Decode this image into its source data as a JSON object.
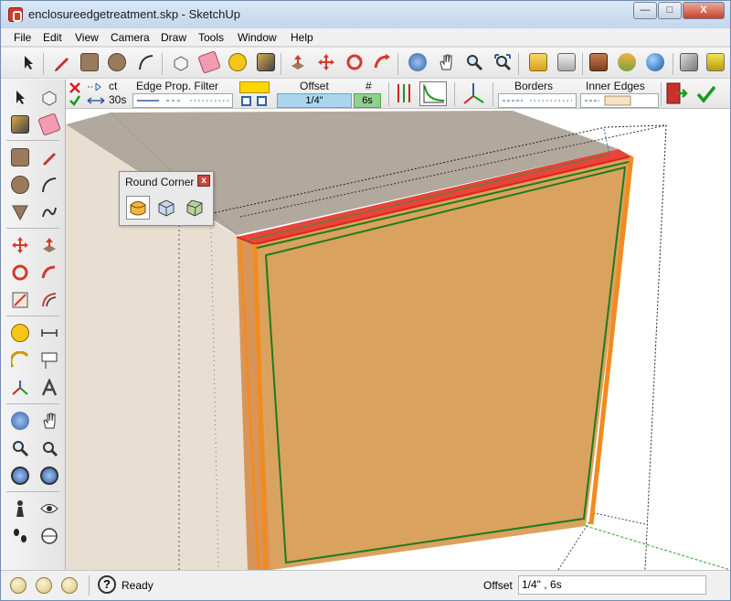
{
  "window": {
    "title": "enclosureedgetreatment.skp - SketchUp",
    "minimize": "—",
    "maximize": "□",
    "close": "X"
  },
  "menu": [
    "File",
    "Edit",
    "View",
    "Camera",
    "Draw",
    "Tools",
    "Window",
    "Help"
  ],
  "edge_treatment_toolbar": {
    "angle_label": "ct",
    "angle_value": "30s",
    "edge_filter_label": "Edge Prop. Filter",
    "offset_label": "Offset",
    "offset_value": "1/4\"",
    "segments_label": "#",
    "segments_value": "6s",
    "borders_label": "Borders",
    "inner_edges_label": "Inner Edges"
  },
  "round_corner_panel": {
    "title": "Round Corner",
    "close": "x",
    "tools": [
      "round-corner-icon",
      "sharp-corner-icon",
      "bevel-icon"
    ]
  },
  "status": {
    "message": "Ready",
    "measurement_label": "Offset",
    "measurement_value": "1/4\" , 6s"
  },
  "colors": {
    "panel_face": "#e2a660",
    "border_red": "#e2231a",
    "border_orange": "#f28b1f",
    "inner_green": "#1f7a1f",
    "enclosure": "#e8ded1",
    "enclosure_top": "#b1a89e"
  }
}
